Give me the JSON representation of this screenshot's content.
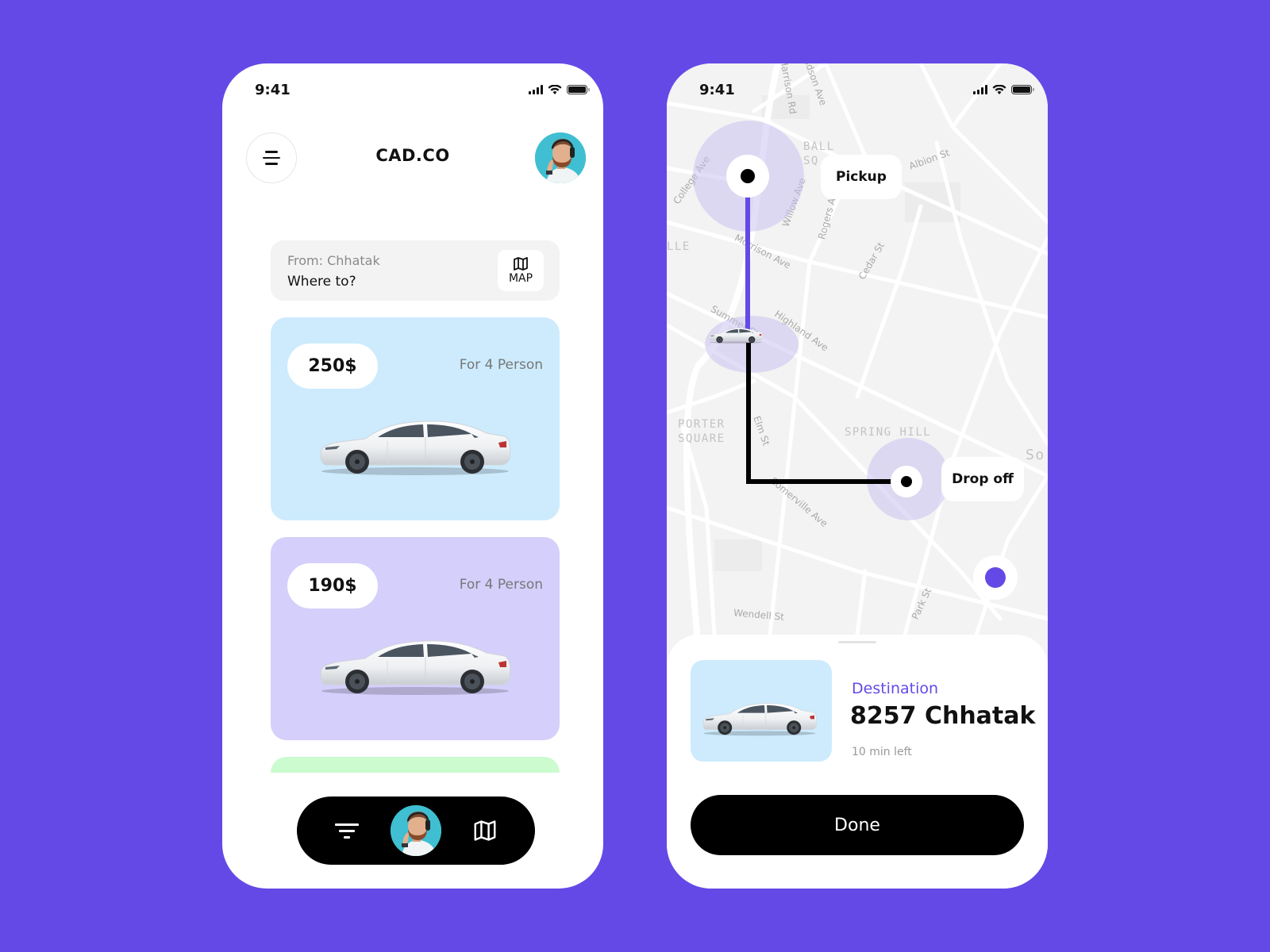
{
  "status_bar": {
    "time": "9:41"
  },
  "home": {
    "brand": "CAD.CO",
    "search": {
      "from_label": "From: Chhatak",
      "placeholder": "Where to?",
      "map_button_label": "MAP"
    },
    "cars": [
      {
        "price": "250$",
        "capacity": "For 4 Person",
        "color": "#CDEBFD"
      },
      {
        "price": "190$",
        "capacity": "For 4 Person",
        "color": "#D5CFFB"
      },
      {
        "price": "",
        "capacity": "",
        "color": "#CBFBCF"
      }
    ],
    "bottom_nav": [
      "filter",
      "profile",
      "map"
    ]
  },
  "ride": {
    "map_labels": {
      "streets": [
        "Harrison Rd",
        "Hudson Ave",
        "College Ave",
        "Willow Ave",
        "Rogers Ave",
        "Albion St",
        "Morrison Ave",
        "Cedar St",
        "Summer St",
        "Highland Ave",
        "Elm St",
        "Somerville Ave",
        "Wendell St",
        "Park St"
      ],
      "areas": [
        "BALL SQ",
        "LLE",
        "PORTER SQUARE",
        "SPRING HILL",
        "So"
      ]
    },
    "pickup_label": "Pickup",
    "dropoff_label": "Drop off",
    "destination": {
      "label": "Destination",
      "value": "8257 Chhatak",
      "eta": "10 min left"
    },
    "done_label": "Done"
  },
  "colors": {
    "accent": "#6549E6",
    "background": "#6549E6",
    "card_blue": "#CDEBFD",
    "card_purple": "#D5CFFB",
    "card_green": "#CBFBCF"
  }
}
